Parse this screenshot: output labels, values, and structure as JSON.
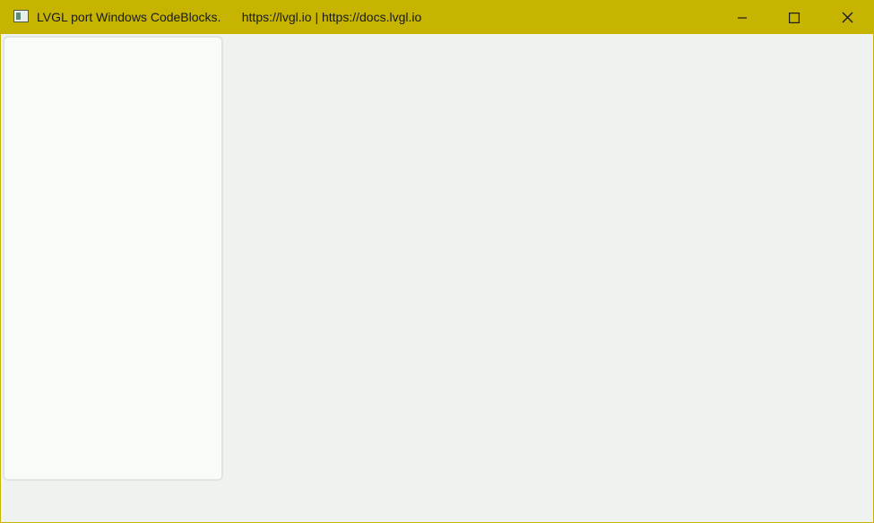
{
  "window": {
    "title": "LVGL port Windows CodeBlocks.      https://lvgl.io | https://docs.lvgl.io",
    "icon": "app-window-icon",
    "controls": {
      "minimize_icon": "minimize-icon",
      "maximize_icon": "maximize-icon",
      "close_icon": "close-icon"
    },
    "colors": {
      "titlebar": "#c6b400",
      "background": "#eff3f0",
      "panel": "#f8fcf9",
      "panel_border": "#e1e5e2"
    }
  }
}
